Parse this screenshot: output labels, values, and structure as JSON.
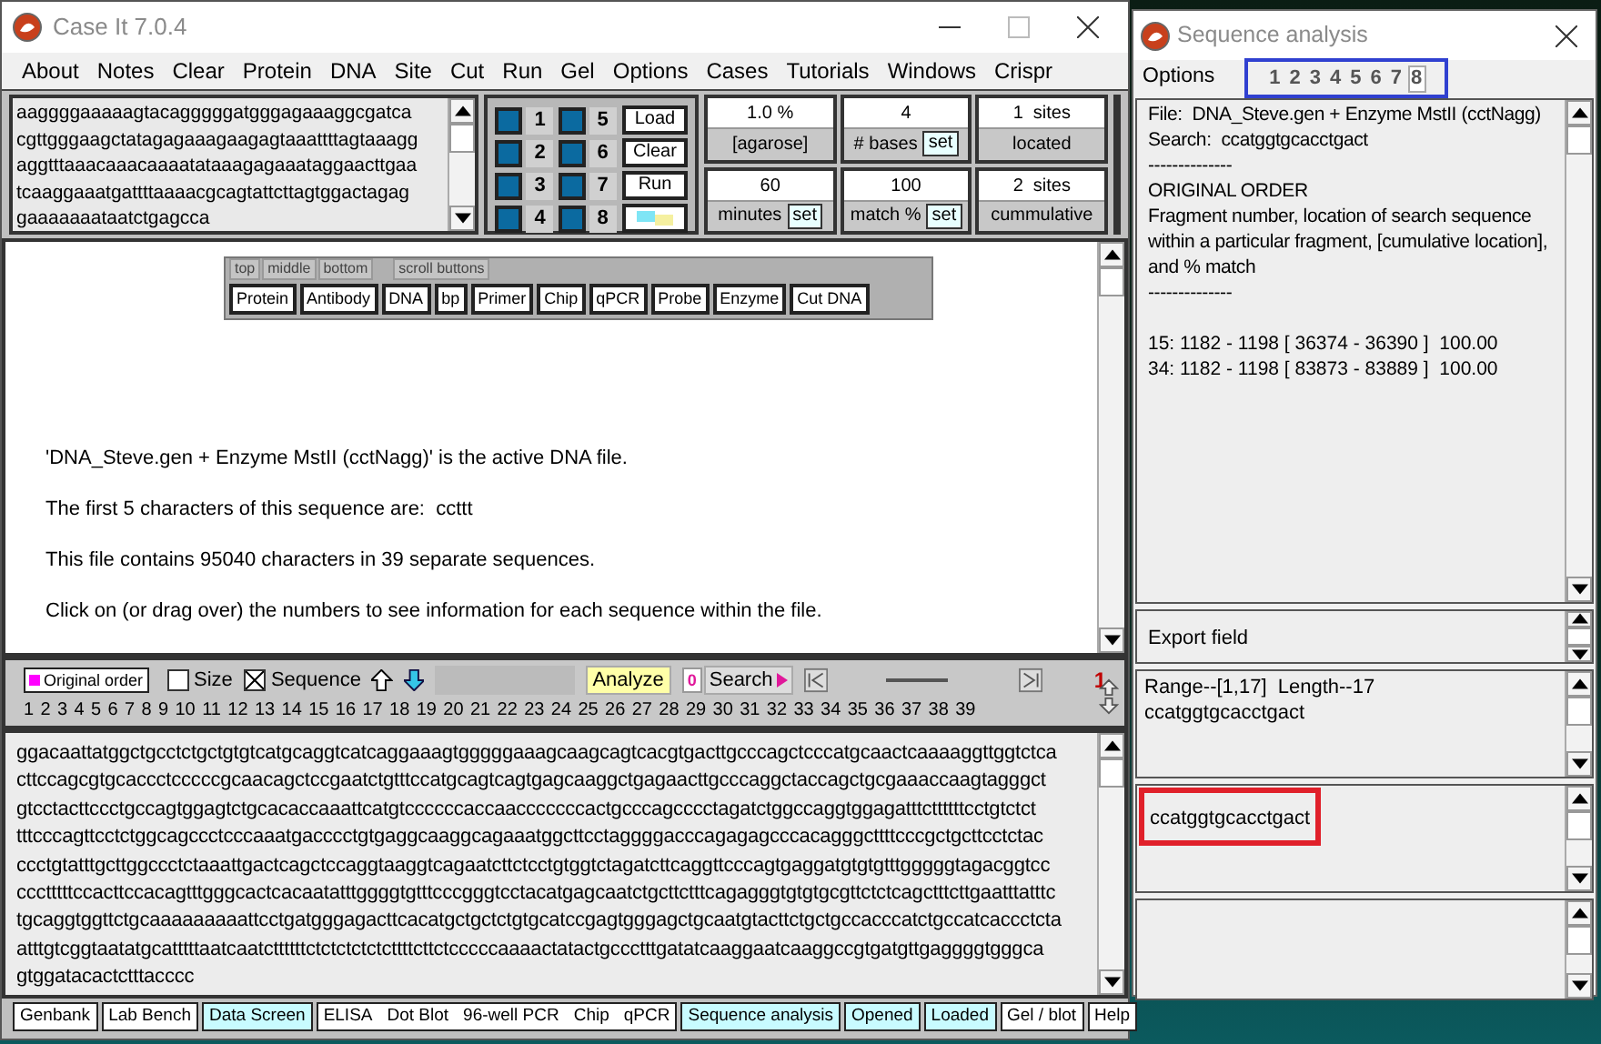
{
  "main_window": {
    "title": "Case It 7.0.4"
  },
  "menu": [
    "About",
    "Notes",
    "Clear",
    "Protein",
    "DNA",
    "Site",
    "Cut",
    "Run",
    "Gel",
    "Options",
    "Cases",
    "Tutorials",
    "Windows",
    "Crispr"
  ],
  "sequence_preview": [
    "aaggggaaaaagtacagggggatgggagaaaggcgatca",
    "cgttgggaagctatagagaaagaagagtaaattttagtaaagg",
    "aggtttaaacaaacaaaatataaagagaaataggaacttgaa",
    "tcaaggaaatgattttaaaacgcagtattcttagtggactagag",
    "gaaaaaaataatctgagcca"
  ],
  "lanes": [
    {
      "number": "1",
      "checked": true
    },
    {
      "number": "5",
      "checked": true
    },
    {
      "number": "2",
      "checked": true
    },
    {
      "number": "6",
      "checked": true
    },
    {
      "number": "3",
      "checked": true
    },
    {
      "number": "7",
      "checked": true
    },
    {
      "number": "4",
      "checked": true
    },
    {
      "number": "8",
      "checked": true
    }
  ],
  "lane_buttons": [
    {
      "kind": "text",
      "label": "Load"
    },
    {
      "kind": "text",
      "label": "Clear"
    },
    {
      "kind": "text",
      "label": "Run"
    },
    {
      "kind": "icon"
    }
  ],
  "settings": [
    {
      "value": "1.0 %",
      "label": "[agarose]"
    },
    {
      "value": "4",
      "label": "# bases",
      "button": "set"
    },
    {
      "value": "1  sites",
      "label": "located"
    },
    {
      "value": "60",
      "label": "minutes",
      "button": "set"
    },
    {
      "value": "100",
      "label": "match %",
      "button": "set"
    },
    {
      "value": "2  sites",
      "label": "cummulative"
    }
  ],
  "floating_toolbar": {
    "tabs": [
      {
        "label": "top",
        "selected": false
      },
      {
        "label": "middle",
        "selected": false
      },
      {
        "label": "bottom",
        "selected": false
      },
      {
        "label": "scroll buttons",
        "selected": false
      }
    ],
    "buttons": [
      "Protein",
      "Antibody",
      "DNA",
      "bp",
      "Primer",
      "Chip",
      "qPCR",
      "Probe",
      "Enzyme",
      "Cut DNA"
    ]
  },
  "info_lines": [
    "'DNA_Steve.gen + Enzyme MstII (cctNagg)' is the active DNA file.",
    "The first 5 characters of this sequence are:  ccttt",
    "This file contains 95040 characters in 39 separate sequences.",
    "Click on (or drag over) the numbers to see information for each sequence within the file."
  ],
  "analysis_toolbar": {
    "order_button": "Original order",
    "size": {
      "label": "Size",
      "checked": false
    },
    "sequence": {
      "label": "Sequence",
      "checked": true
    },
    "analyze": "Analyze",
    "count": "0",
    "search": "Search",
    "page": "1",
    "slider": {
      "level": 0.5
    },
    "numbers": [
      "1",
      "2",
      "3",
      "4",
      "5",
      "6",
      "7",
      "8",
      "9",
      "10",
      "11",
      "12",
      "13",
      "14",
      "15",
      "16",
      "17",
      "18",
      "19",
      "20",
      "21",
      "22",
      "23",
      "24",
      "25",
      "26",
      "27",
      "28",
      "29",
      "30",
      "31",
      "32",
      "33",
      "34",
      "35",
      "36",
      "37",
      "38",
      "39"
    ]
  },
  "sequence_lines": [
    "ggacaattatggctgcctctgctgtgtcatgcaggtcatcaggaaagtgggggaaagcaagcagtcacgtgacttgcccagctcccatgcaactcaaaaggttggtctca",
    "cttccagcgtgcaccctcccccgcaacagctccgaatctgtttccatgcagtcagtgagcaaggctgagaacttgcccaggctaccagctgcgaaaccaagtagggct",
    "gtcctacttccctgccagtggagtctgcacaccaaattcatgtccccccaccaacccccccactgcccagcccctagatctggccaggtggagatttcttttttcctgtctct",
    "tttcccagttcctctggcagccctcccaaatgacccctgtgaggcaaggcagaaatggcttcctaggggacccagagagcccacagggcttttcccgctgcttcctctac",
    "ccctgtatttgcttggccctctaaattgactcagctccaggtaaggtcagaatcttctcctgtggtctagatcttcaggttcccagtgaggatgtgtgtttgggggtagacggtcc",
    "ccctttttccacttccacagtttgggcactcacaatatttggggtgtttcccgggtcctacatgagcaatctgcttctttcagagggtgtgtgcgttctctcagctttcttgaatttatttc",
    "tgcaggtggttctgcaaaaaaaaattcctgatgggagacttcacatgctgctctgtgcatccgagtgggagctgcaatgtacttctgctgccacccatctgccatcaccctcta",
    "atttgtcggtaatatgcatttttaatcaatcttttttctctctctctcttttcttctcccccaaaactatactgccctttgatatcaaggaatcaaggccgtgatgttgaggggtgggca",
    "gtggatacactctttacccc"
  ],
  "bottom_buttons": [
    {
      "kind": "single",
      "label": "Genbank",
      "highlighted": false
    },
    {
      "kind": "single",
      "label": "Lab Bench",
      "highlighted": false
    },
    {
      "kind": "single",
      "label": "Data Screen",
      "highlighted": true
    },
    {
      "kind": "group",
      "labels": [
        "ELISA",
        "Dot Blot",
        "96-well PCR",
        "Chip",
        "qPCR"
      ],
      "highlighted": false
    },
    {
      "kind": "single",
      "label": "Sequence analysis",
      "highlighted": true
    },
    {
      "kind": "single",
      "label": "Opened",
      "highlighted": true
    },
    {
      "kind": "single",
      "label": "Loaded",
      "highlighted": true
    },
    {
      "kind": "single",
      "label": "Gel / blot",
      "highlighted": false
    },
    {
      "kind": "single",
      "label": "Help",
      "highlighted": false
    }
  ],
  "analysis_window": {
    "title": "Sequence analysis",
    "menu": "Options",
    "tabs": [
      {
        "label": "1",
        "selected": false
      },
      {
        "label": "2",
        "selected": false
      },
      {
        "label": "3",
        "selected": false
      },
      {
        "label": "4",
        "selected": false
      },
      {
        "label": "5",
        "selected": false
      },
      {
        "label": "6",
        "selected": false
      },
      {
        "label": "7",
        "selected": false
      },
      {
        "label": "8",
        "selected": true
      }
    ],
    "report_lines": [
      "File:  DNA_Steve.gen + Enzyme MstII (cctNagg)",
      "Search:  ccatggtgcacctgact",
      "--------------",
      "ORIGINAL ORDER",
      "Fragment number, location of search sequence within a particular fragment, [cumulative location], and % match",
      "--------------"
    ],
    "results": [
      "15: 1182 - 1198 [ 36374 - 36390 ]  100.00",
      "34: 1182 - 1198 [ 83873 - 83889 ]  100.00"
    ],
    "export_field": "Export field",
    "range_lines": [
      "Range--[1,17]  Length--17",
      "ccatggtgcacctgact"
    ],
    "search_field": "ccatggtgcacctgact"
  }
}
